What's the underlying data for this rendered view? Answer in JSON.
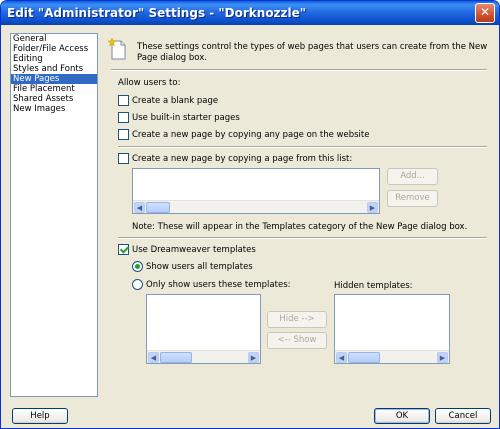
{
  "window": {
    "title": "Edit \"Administrator\" Settings - \"Dorknozzle\"",
    "close_glyph": "✕"
  },
  "categories": [
    {
      "label": "General"
    },
    {
      "label": "Folder/File Access"
    },
    {
      "label": "Editing"
    },
    {
      "label": "Styles and Fonts"
    },
    {
      "label": "New Pages",
      "selected": true
    },
    {
      "label": "File Placement"
    },
    {
      "label": "Shared Assets"
    },
    {
      "label": "New Images"
    }
  ],
  "panel": {
    "info_icon": "new-page-icon",
    "description_line1": "These settings control the types of web pages that users can create from the New",
    "description_line2": "Page dialog box.",
    "allow_label": "Allow users to:",
    "options": {
      "blank_page": {
        "label": "Create a blank page",
        "checked": false
      },
      "starter_pages": {
        "label": "Use built-in starter pages",
        "checked": false
      },
      "copy_any_page": {
        "label": "Create a new page by copying any page on the website",
        "checked": false
      },
      "copy_from_list": {
        "label": "Create a new page by copying a page from this list:",
        "checked": false
      }
    },
    "add_button": "Add...",
    "remove_button": "Remove",
    "note": "Note: These will appear in the Templates category of the New Page dialog box.",
    "use_templates": {
      "label": "Use Dreamweaver templates",
      "checked": true
    },
    "show_all_templates": {
      "label": "Show users all templates",
      "selected": true
    },
    "show_only_these": {
      "label": "Only show users these templates:",
      "selected": false
    },
    "hidden_templates_label": "Hidden templates:",
    "hide_button": "Hide -->",
    "show_button": "<-- Show"
  },
  "footer": {
    "help_button": "Help",
    "ok_button": "OK",
    "cancel_button": "Cancel"
  },
  "colors": {
    "titlebar": "#0a4fc9",
    "dialog_bg": "#ece9d8",
    "selection": "#316ac5"
  }
}
